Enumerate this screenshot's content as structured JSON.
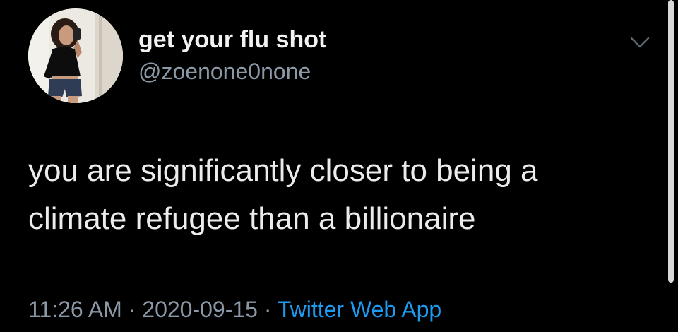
{
  "tweet": {
    "display_name": "get your flu shot",
    "handle": "@zoenone0none",
    "text_lines": [
      "you are significantly closer to being a",
      "climate refugee than a billionaire"
    ],
    "time": "11:26 AM",
    "separator": " · ",
    "date": "2020-09-15",
    "source": "Twitter Web App"
  },
  "icons": {
    "menu": "chevron-down-icon",
    "avatar": "profile-photo"
  },
  "colors": {
    "background": "#000000",
    "name": "#f2f2f2",
    "secondary": "#8b98a5",
    "link": "#1d9bf0",
    "body_text": "#ececec"
  }
}
